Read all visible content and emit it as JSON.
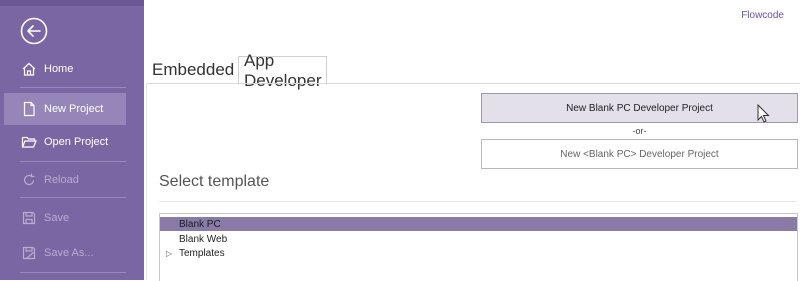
{
  "app": {
    "name": "Flowcode"
  },
  "sidebar": {
    "items": [
      {
        "label": "Home",
        "icon": "home-icon",
        "state": "normal"
      },
      {
        "label": "New Project",
        "icon": "new-document-icon",
        "state": "active"
      },
      {
        "label": "Open Project",
        "icon": "open-folder-icon",
        "state": "normal"
      },
      {
        "label": "Reload",
        "icon": "reload-icon",
        "state": "disabled"
      },
      {
        "label": "Save",
        "icon": "save-icon",
        "state": "disabled"
      },
      {
        "label": "Save As...",
        "icon": "save-as-icon",
        "state": "disabled"
      }
    ]
  },
  "tabs": [
    {
      "label": "Embedded",
      "selected": false
    },
    {
      "label": "App Developer",
      "selected": true
    }
  ],
  "actions": {
    "primary_label": "New Blank PC Developer Project",
    "or_label": "-or-",
    "secondary_label": "New <Blank PC> Developer Project"
  },
  "template_section": {
    "title": "Select template",
    "items": [
      {
        "label": "Blank PC",
        "selected": true
      },
      {
        "label": "Blank Web",
        "selected": false
      },
      {
        "label": "Templates",
        "selected": false,
        "expandable": true
      }
    ]
  },
  "colors": {
    "sidebar_bg": "#7a66a3",
    "sidebar_active": "#9585b8",
    "accent": "#6b4fa0",
    "selection": "#8a7aa8"
  }
}
